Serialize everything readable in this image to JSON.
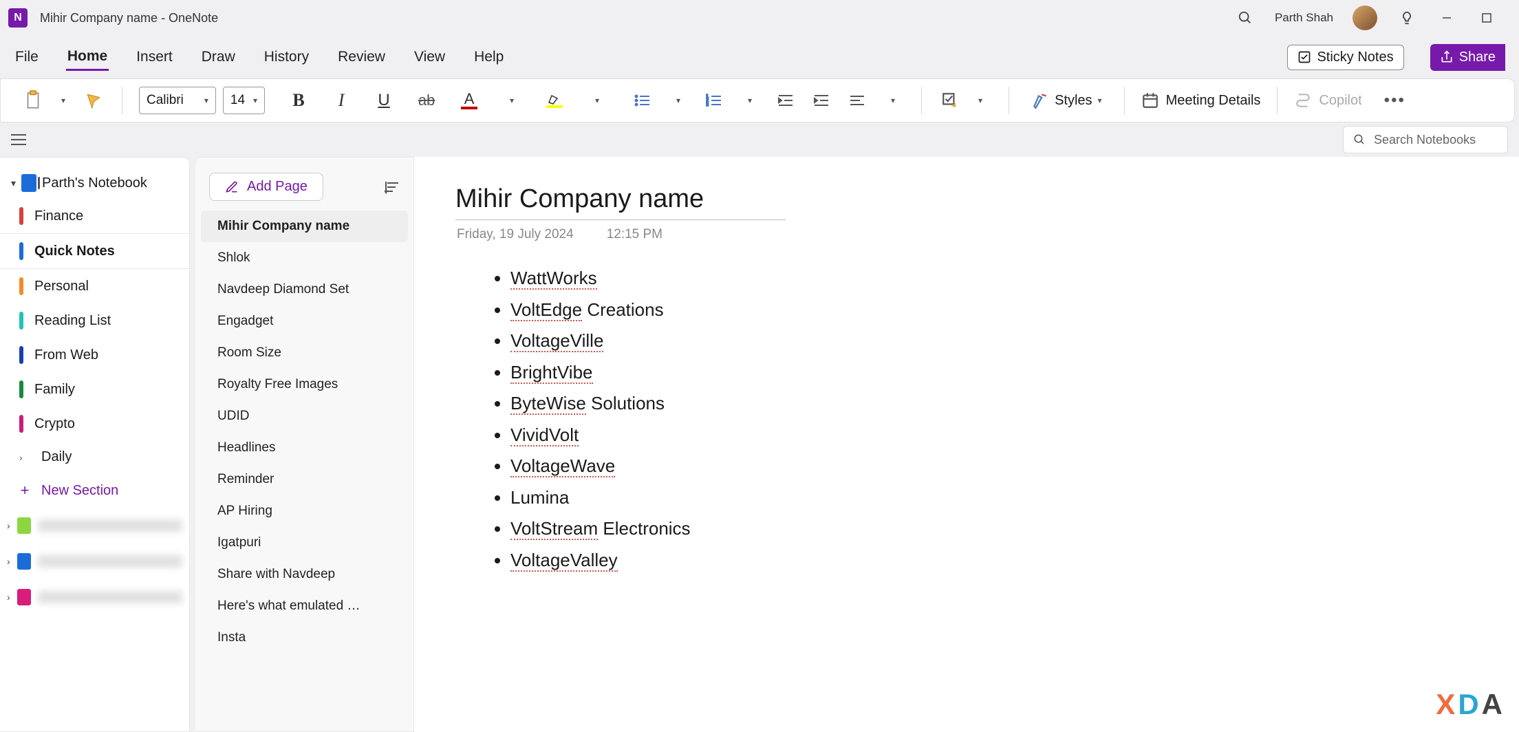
{
  "app": {
    "title": "Mihir Company name   -  OneNote",
    "icon_letter": "N"
  },
  "user": {
    "name": "Parth Shah"
  },
  "menu": {
    "file": "File",
    "home": "Home",
    "insert": "Insert",
    "draw": "Draw",
    "history": "History",
    "review": "Review",
    "view": "View",
    "help": "Help",
    "sticky_notes": "Sticky Notes",
    "share": "Share"
  },
  "ribbon": {
    "font_name": "Calibri",
    "font_size": "14",
    "styles": "Styles",
    "meeting": "Meeting Details",
    "copilot": "Copilot"
  },
  "search": {
    "placeholder": "Search Notebooks"
  },
  "notebook": {
    "name": "Parth's Notebook",
    "sections": [
      {
        "label": "Finance",
        "color": "#d64141"
      },
      {
        "label": "Quick Notes",
        "color": "#1a6dd8",
        "active": true
      },
      {
        "label": "Personal",
        "color": "#f28c28"
      },
      {
        "label": "Reading List",
        "color": "#26c0b4"
      },
      {
        "label": "From Web",
        "color": "#1a3fb0"
      },
      {
        "label": "Family",
        "color": "#1a8a3a"
      },
      {
        "label": "Crypto",
        "color": "#c81d7a"
      }
    ],
    "daily": "Daily",
    "new_section": "New Section",
    "other_nbs": [
      {
        "color": "#8cd63f"
      },
      {
        "color": "#1a6dd8"
      },
      {
        "color": "#d81d7a"
      }
    ]
  },
  "pages": {
    "add": "Add Page",
    "items": [
      "Mihir Company name",
      "Shlok",
      "Navdeep Diamond Set",
      "Engadget",
      "Room Size",
      "Royalty Free Images",
      "UDID",
      "Headlines",
      "Reminder",
      "AP Hiring",
      "Igatpuri",
      "Share with Navdeep",
      "Here's what emulated …",
      "Insta"
    ]
  },
  "page": {
    "title": "Mihir Company name",
    "date": "Friday, 19 July 2024",
    "time": "12:15 PM",
    "bullets": [
      {
        "sp": "WattWorks",
        "rest": ""
      },
      {
        "sp": "VoltEdge",
        "rest": " Creations"
      },
      {
        "sp": "VoltageVille",
        "rest": ""
      },
      {
        "sp": "BrightVibe",
        "rest": ""
      },
      {
        "sp": "ByteWise",
        "rest": " Solutions"
      },
      {
        "sp": "VividVolt",
        "rest": ""
      },
      {
        "sp": "VoltageWave",
        "rest": ""
      },
      {
        "sp": "",
        "rest": "Lumina"
      },
      {
        "sp": "VoltStream",
        "rest": " Electronics"
      },
      {
        "sp": "VoltageValley",
        "rest": ""
      }
    ]
  }
}
